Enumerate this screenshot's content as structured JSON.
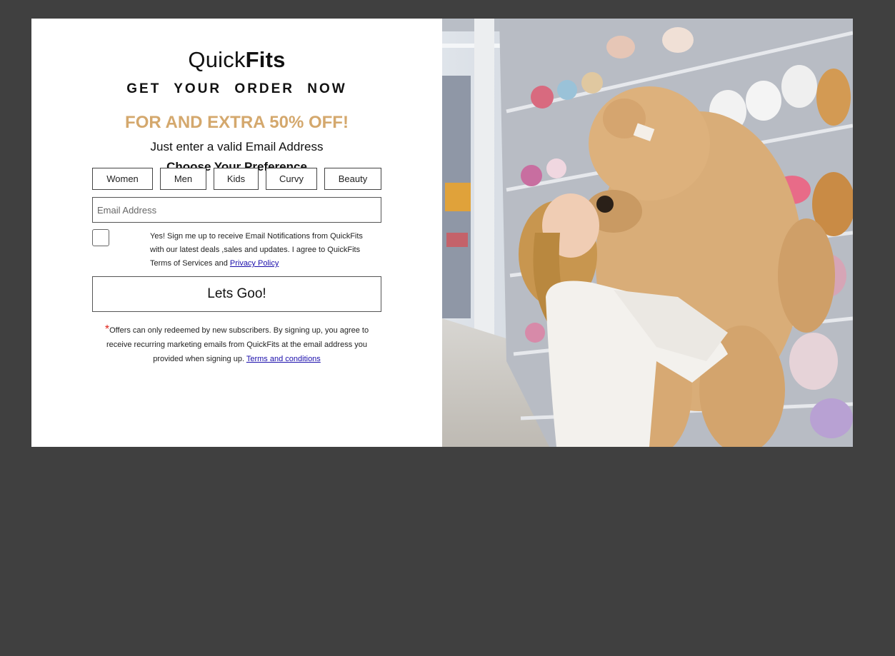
{
  "brand": {
    "part1": "Quick",
    "part2": "Fits"
  },
  "headline": "GET YOUR ORDER NOW",
  "offer": "FOR AND EXTRA 50% OFF!",
  "subtitle": "Just enter a valid Email Address",
  "preference_title": "Choose Your Preference",
  "preferences": [
    "Women",
    "Men",
    "Kids",
    "Curvy",
    "Beauty"
  ],
  "email_field": {
    "placeholder": "Email Address",
    "value": ""
  },
  "consent": {
    "checked": false,
    "text": "Yes! Sign me up to receive Email Notifications from QuickFits with our latest deals ,sales and updates. I agree to QuickFits Terms of Services and ",
    "link": "Privacy Policy"
  },
  "submit_label": "Lets Goo!",
  "disclaimer": {
    "asterisk": "*",
    "text": "Offers can only redeemed by new subscribers. By signing up, you agree to receive recurring marketing emails from QuickFits at the email address you provided when signing up. ",
    "link": "Terms and conditions"
  },
  "colors": {
    "accent": "#d4a86d",
    "backdrop": "#404040",
    "link": "#1a0dab"
  },
  "hero_image": {
    "alt": "Woman hugging a giant teddy bear in a toy store aisle"
  }
}
